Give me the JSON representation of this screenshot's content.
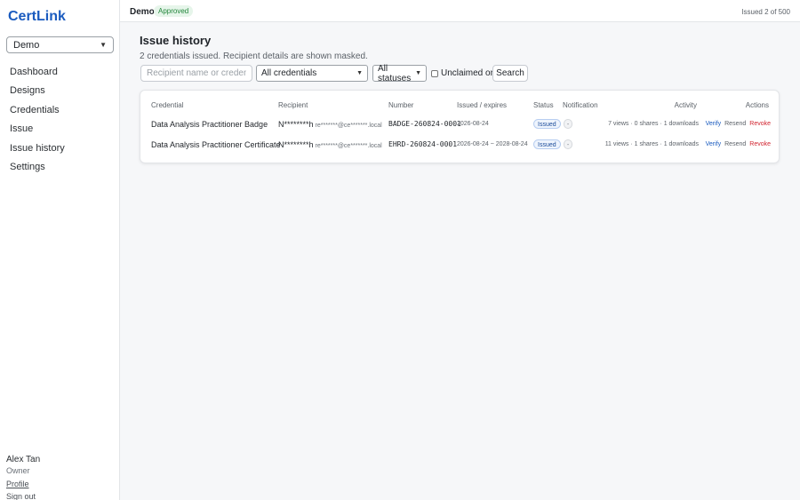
{
  "app": {
    "brand": "CertLink"
  },
  "sidebar": {
    "org_selector": {
      "selected": "Demo",
      "icon": "chevron-down-icon"
    },
    "nav_items": [
      {
        "label": "Dashboard"
      },
      {
        "label": "Designs"
      },
      {
        "label": "Credentials"
      },
      {
        "label": "Issue"
      },
      {
        "label": "Issue history"
      },
      {
        "label": "Settings"
      }
    ],
    "user": {
      "name": "Alex Tan",
      "role": "Owner",
      "profile_label": "Profile",
      "signout_label": "Sign out"
    }
  },
  "topbar": {
    "org_name": "Demo",
    "status_badge": "Approved",
    "issued_count": "Issued 2 of 500"
  },
  "page": {
    "title": "Issue history",
    "subtitle": "2 credentials issued. Recipient details are shown masked."
  },
  "filters": {
    "search_placeholder": "Recipient name or credential number",
    "credential_select": "All credentials",
    "status_select": "All statuses",
    "unclaimed_label": "Unclaimed only",
    "unclaimed_checked": false,
    "search_button": "Search"
  },
  "table": {
    "headers": {
      "credential": "Credential",
      "recipient": "Recipient",
      "number": "Number",
      "issued": "Issued / expires",
      "status": "Status",
      "notification": "Notification",
      "activity": "Activity",
      "actions": "Actions"
    },
    "rows": [
      {
        "credential": "Data Analysis Practitioner Badge",
        "recipient_name": "N********h",
        "recipient_email": "re*******@ce*******.local",
        "number": "BADGE-260824-0001",
        "dates": "2026-08-24",
        "status": "Issued",
        "notification": "-",
        "activity": "7 views · 0 shares · 1 downloads",
        "actions": {
          "verify": "Verify",
          "resend": "Resend",
          "revoke": "Revoke"
        }
      },
      {
        "credential": "Data Analysis Practitioner Certificate",
        "recipient_name": "N********h",
        "recipient_email": "re*******@ce*******.local",
        "number": "EHRD-260824-0001",
        "dates": "2026-08-24 ~ 2028-08-24",
        "status": "Issued",
        "notification": "-",
        "activity": "11 views · 1 shares · 1 downloads",
        "actions": {
          "verify": "Verify",
          "resend": "Resend",
          "revoke": "Revoke"
        }
      }
    ]
  },
  "colors": {
    "brand": "#1a5bbf",
    "approved": "#23863b",
    "revoke": "#d1242f",
    "status_issued_bg": "#eef4fd"
  }
}
